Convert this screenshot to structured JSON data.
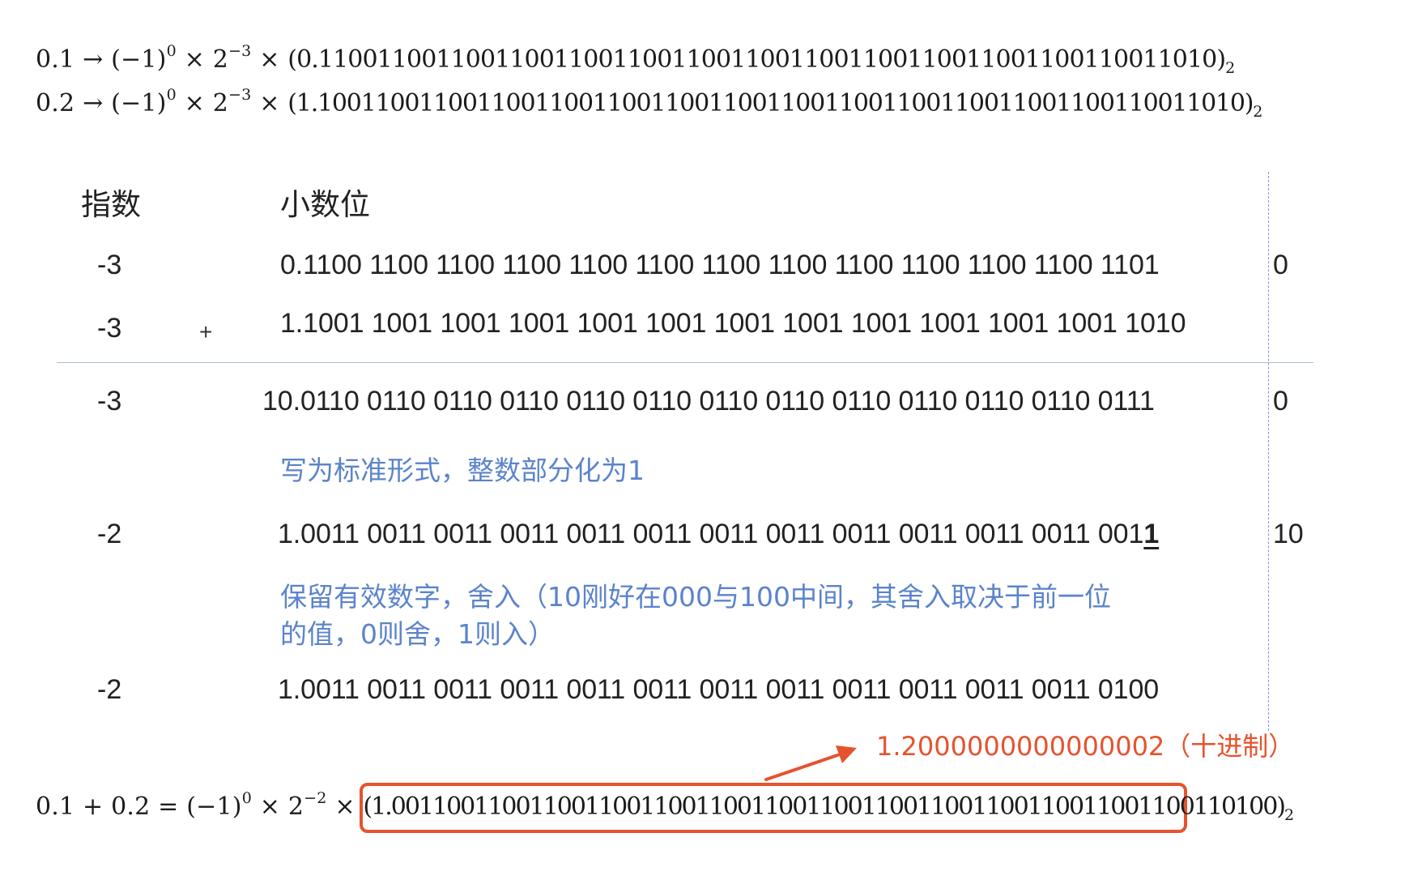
{
  "formulas": {
    "line1": {
      "lhs": "0.1",
      "arrow": "→",
      "sign": "(−1)",
      "sign_exp": "0",
      "times1": "×",
      "base": "2",
      "base_exp": "−3",
      "times2": "×",
      "mantissa": "(0.1100110011001100110011001100110011001100110011001100110011010)",
      "radix": "2"
    },
    "line2": {
      "lhs": "0.2",
      "arrow": "→",
      "sign": "(−1)",
      "sign_exp": "0",
      "times1": "×",
      "base": "2",
      "base_exp": "−3",
      "times2": "×",
      "mantissa": "(1.1001100110011001100110011001100110011001100110011001100110011010)",
      "radix": "2"
    }
  },
  "table": {
    "header_exponent": "指数",
    "header_fraction": "小数位",
    "rows": [
      {
        "exponent": "-3",
        "operator": "",
        "bits": "0.1100 1100 1100 1100 1100 1100 1100 1100 1100 1100 1100 1100 1101",
        "tail": "0"
      },
      {
        "exponent": "-3",
        "operator": "+",
        "bits": "1.1001 1001 1001 1001 1001 1001 1001 1001 1001 1001 1001 1001 1010",
        "tail": ""
      },
      {
        "exponent": "-3",
        "operator": "",
        "bits": "10.0110 0110 0110 0110 0110 0110 0110 0110 0110 0110 0110 0110 0111",
        "tail": "0"
      },
      {
        "exponent": "-2",
        "operator": "",
        "bits_main": "1.0011 0011 0011 0011 0011 0011 0011 0011 0011 0011 0011 0011 001",
        "bits_underlined": "1",
        "tail": "10"
      },
      {
        "exponent": "-2",
        "operator": "",
        "bits": "1.0011 0011 0011 0011 0011 0011 0011 0011 0011 0011 0011 0011 0100",
        "tail": ""
      }
    ],
    "note1": "写为标准形式，整数部分化为1",
    "note2_line1": "保留有效数字，舍入（10刚好在000与100中间，其舍入取决于前一位",
    "note2_line2": "的值，0则舍，1则入）"
  },
  "annotation": {
    "decimal_value": "1.2000000000000002（十进制）"
  },
  "result": {
    "lhs": "0.1 + 0.2 =",
    "sign": "(−1)",
    "sign_exp": "0",
    "times1": "×",
    "base": "2",
    "base_exp": "−2",
    "times2": "×",
    "mantissa": "(1.0011001100110011001100110011001100110011001100110011001100110100)",
    "radix": "2"
  },
  "colors": {
    "note_blue": "#5b83cc",
    "highlight_red": "#e5532e",
    "rule_blue": "#a9bde0"
  }
}
